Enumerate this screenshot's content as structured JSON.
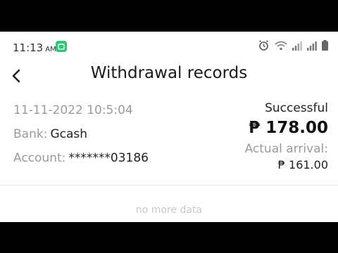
{
  "status_bar": {
    "time": "11:13",
    "ampm": "AM",
    "icons": [
      "app-notification-icon",
      "alarm-icon",
      "wifi-icon",
      "signal-icon",
      "signal-icon",
      "battery-icon"
    ]
  },
  "header": {
    "back_icon": "chevron-left-icon",
    "title": "Withdrawal records"
  },
  "record": {
    "datetime": "11-11-2022 10:5:04",
    "bank_label": "Bank:",
    "bank_value": "Gcash",
    "account_label": "Account:",
    "account_value": "*******03186",
    "status": "Successful",
    "amount": "₱ 178.00",
    "arrival_label": "Actual arrival:",
    "arrival_value": "₱ 161.00"
  },
  "footer": {
    "no_more": "no more data"
  },
  "colors": {
    "app_notification": "#32c47a",
    "muted_text": "#9a9a9a",
    "primary_text": "#222222"
  }
}
